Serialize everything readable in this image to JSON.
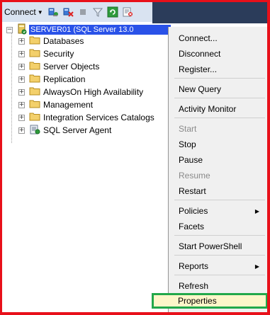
{
  "toolbar": {
    "connect_label": "Connect",
    "icons": [
      "connect-object-explorer-icon",
      "disconnect-icon",
      "stop-icon",
      "filter-icon",
      "refresh-icon",
      "summary-icon"
    ]
  },
  "tree": {
    "server_label": "SERVER01 (SQL Server 13.0",
    "items": [
      {
        "label": "Databases"
      },
      {
        "label": "Security"
      },
      {
        "label": "Server Objects"
      },
      {
        "label": "Replication"
      },
      {
        "label": "AlwaysOn High Availability"
      },
      {
        "label": "Management"
      },
      {
        "label": "Integration Services Catalogs"
      },
      {
        "label": "SQL Server Agent"
      }
    ]
  },
  "context_menu": {
    "items": [
      {
        "label": "Connect..."
      },
      {
        "label": "Disconnect"
      },
      {
        "label": "Register..."
      },
      {
        "label": "New Query"
      },
      {
        "label": "Activity Monitor"
      },
      {
        "label": "Start",
        "disabled": true
      },
      {
        "label": "Stop"
      },
      {
        "label": "Pause"
      },
      {
        "label": "Resume",
        "disabled": true
      },
      {
        "label": "Restart"
      },
      {
        "label": "Policies",
        "submenu": true
      },
      {
        "label": "Facets"
      },
      {
        "label": "Start PowerShell"
      },
      {
        "label": "Reports",
        "submenu": true
      },
      {
        "label": "Refresh"
      },
      {
        "label": "Properties",
        "highlighted": true
      }
    ]
  },
  "colors": {
    "frame": "#e8101a",
    "highlight_border": "#22a84a",
    "highlight_fill": "#fdf6c9",
    "selection": "#2a52e8"
  }
}
